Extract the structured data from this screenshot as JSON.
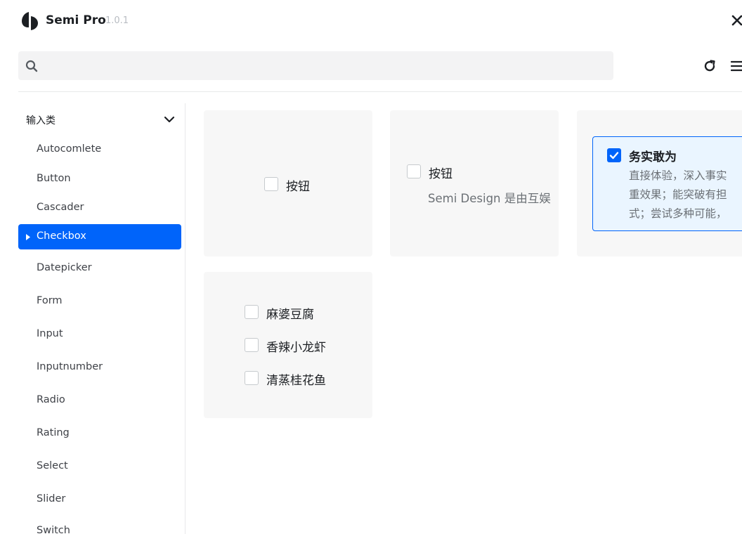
{
  "app": {
    "name": "Semi Pro",
    "version": "1.0.1"
  },
  "search": {
    "placeholder": "",
    "value": ""
  },
  "sidebar": {
    "group_title": "输入类",
    "items": [
      {
        "label": "Autocomlete"
      },
      {
        "label": "Button"
      },
      {
        "label": "Cascader"
      },
      {
        "label": "Checkbox",
        "active": true
      },
      {
        "label": "Datepicker"
      },
      {
        "label": "Form"
      },
      {
        "label": "Input"
      },
      {
        "label": "Inputnumber"
      },
      {
        "label": "Radio"
      },
      {
        "label": "Rating"
      },
      {
        "label": "Select"
      },
      {
        "label": "Slider"
      },
      {
        "label": "Switch"
      }
    ]
  },
  "cards": {
    "basic": {
      "label": "按钮",
      "checked": false
    },
    "with_desc": {
      "label": "按钮",
      "description": "Semi Design 是由互娱",
      "checked": false
    },
    "card_style": {
      "title": "务实敢为",
      "desc_lines": [
        "直接体验，深入事实",
        "重效果；能突破有担",
        "式；尝试多种可能，"
      ],
      "checked": true
    },
    "group": {
      "options": [
        {
          "label": "麻婆豆腐",
          "checked": false
        },
        {
          "label": "香辣小龙虾",
          "checked": false
        },
        {
          "label": "清蒸桂花鱼",
          "checked": false
        }
      ]
    }
  },
  "colors": {
    "accent": "#0064fa",
    "card_bg": "#f7f7f7",
    "checked_card_bg": "#eaf5ff"
  },
  "icons": [
    "semi-logo-icon",
    "close-icon",
    "search-icon",
    "refresh-icon",
    "menu-icon",
    "chevron-down-icon",
    "caret-right-icon",
    "check-icon"
  ]
}
